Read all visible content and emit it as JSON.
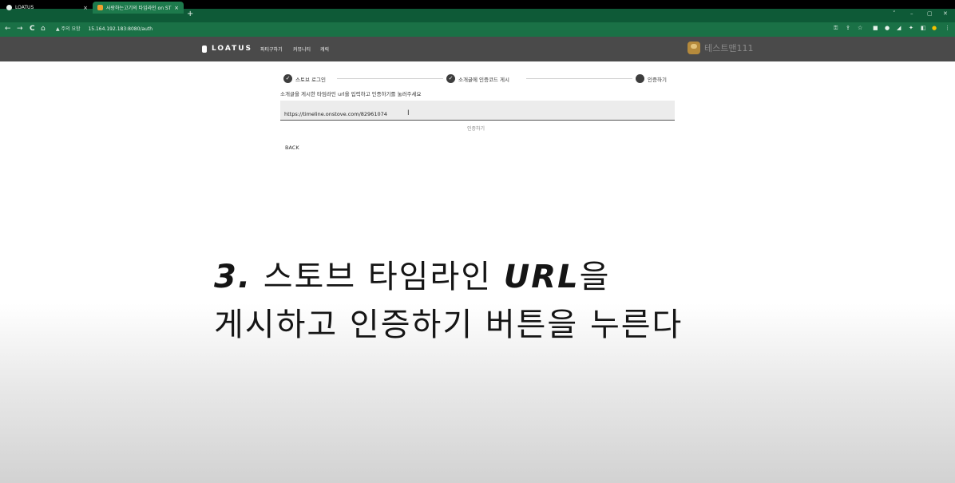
{
  "browser": {
    "tabs": [
      {
        "title": "LOATUS",
        "active": false
      },
      {
        "title": "사랑하는고기의 타임라인 on ST",
        "active": true
      }
    ],
    "new_tab": "+",
    "window_controls": [
      "˅",
      "–",
      "▢",
      "✕"
    ],
    "nav": {
      "back": "←",
      "forward": "→",
      "reload": "C",
      "home": "⌂"
    },
    "address": {
      "warning": "▲ 주의 요함",
      "url": "15.164.192.183:8080/auth"
    }
  },
  "site": {
    "logo": "LOATUS",
    "menu": [
      "파티구하기",
      "커뮤니티",
      "캐릭"
    ],
    "user_name": "테스트맨111"
  },
  "stepper": {
    "steps": [
      {
        "label": "스토브 로그인",
        "done": true
      },
      {
        "label": "소개글에 인증코드 게시",
        "done": true
      },
      {
        "label": "인증하기",
        "done": false
      }
    ]
  },
  "form": {
    "instruction": "소개글을 게시한 타임라인 url을 입력하고 인증하기를 눌러주세요",
    "url_value": "https://timeline.onstove.com/82961074",
    "verify_label": "인증하기",
    "back_label": "BACK"
  },
  "caption": {
    "line1_prefix": "3.",
    "line1_mid": "스토브 타임라인",
    "line1_bold": "URL",
    "line1_suffix": "을",
    "line2": "게시하고 인증하기 버튼을 누른다"
  }
}
